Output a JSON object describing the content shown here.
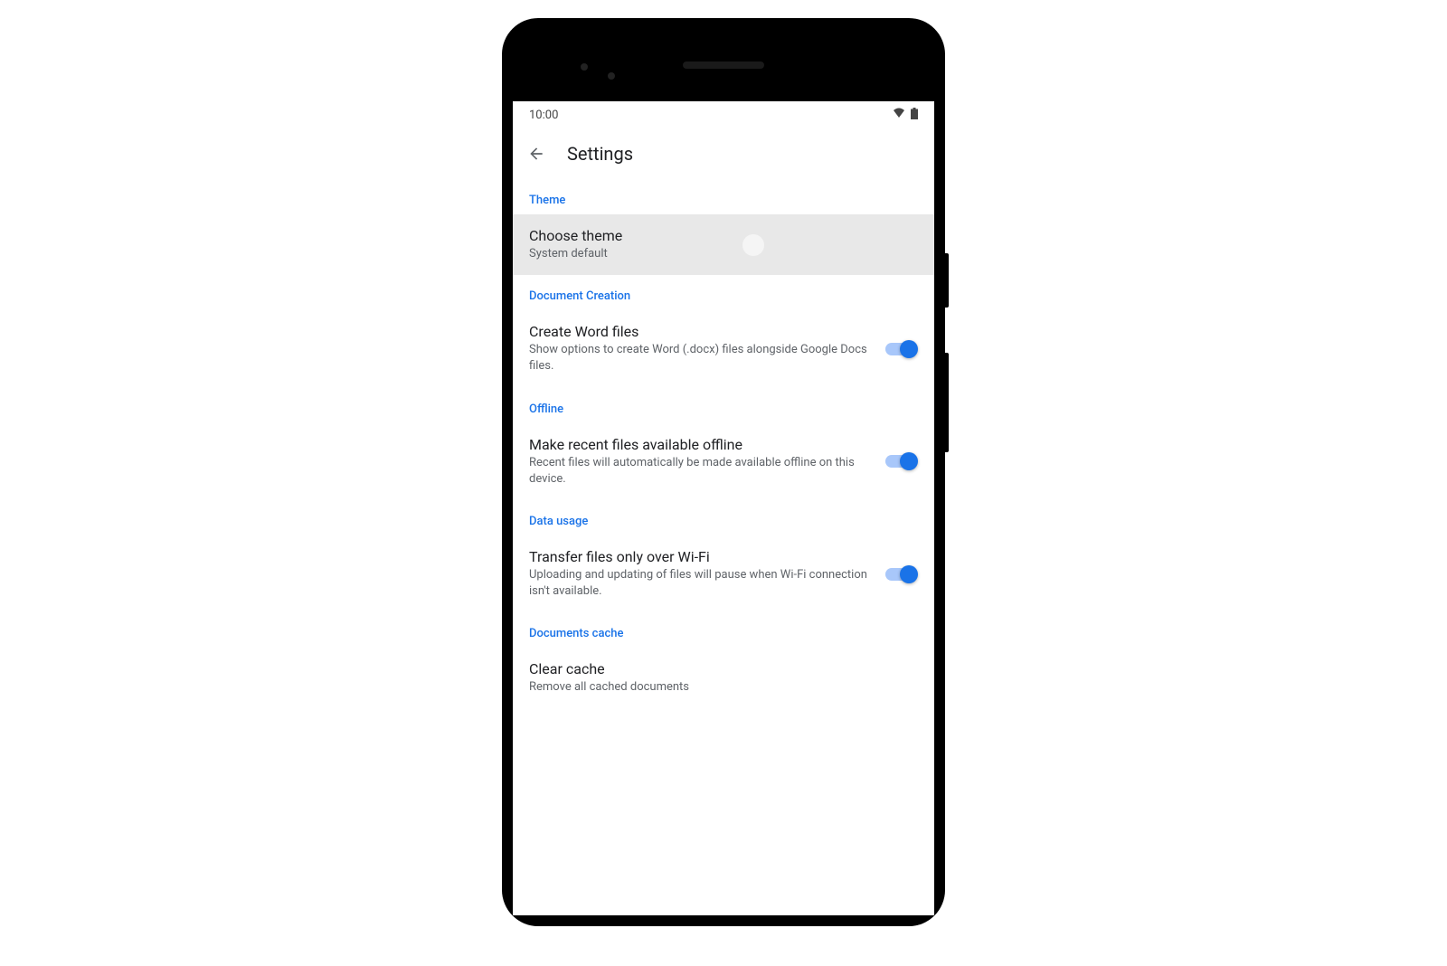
{
  "statusBar": {
    "time": "10:00"
  },
  "appBar": {
    "title": "Settings"
  },
  "sections": {
    "theme": {
      "header": "Theme",
      "chooseTheme": {
        "title": "Choose theme",
        "subtitle": "System default"
      }
    },
    "documentCreation": {
      "header": "Document Creation",
      "createWord": {
        "title": "Create Word files",
        "subtitle": "Show options to create Word (.docx) files alongside Google Docs files."
      }
    },
    "offline": {
      "header": "Offline",
      "makeAvailable": {
        "title": "Make recent files available offline",
        "subtitle": "Recent files will automatically be made available offline on this device."
      }
    },
    "dataUsage": {
      "header": "Data usage",
      "wifiOnly": {
        "title": "Transfer files only over Wi-Fi",
        "subtitle": "Uploading and updating of files will pause when Wi-Fi connection isn't available."
      }
    },
    "documentsCache": {
      "header": "Documents cache",
      "clearCache": {
        "title": "Clear cache",
        "subtitle": "Remove all cached documents"
      }
    }
  }
}
